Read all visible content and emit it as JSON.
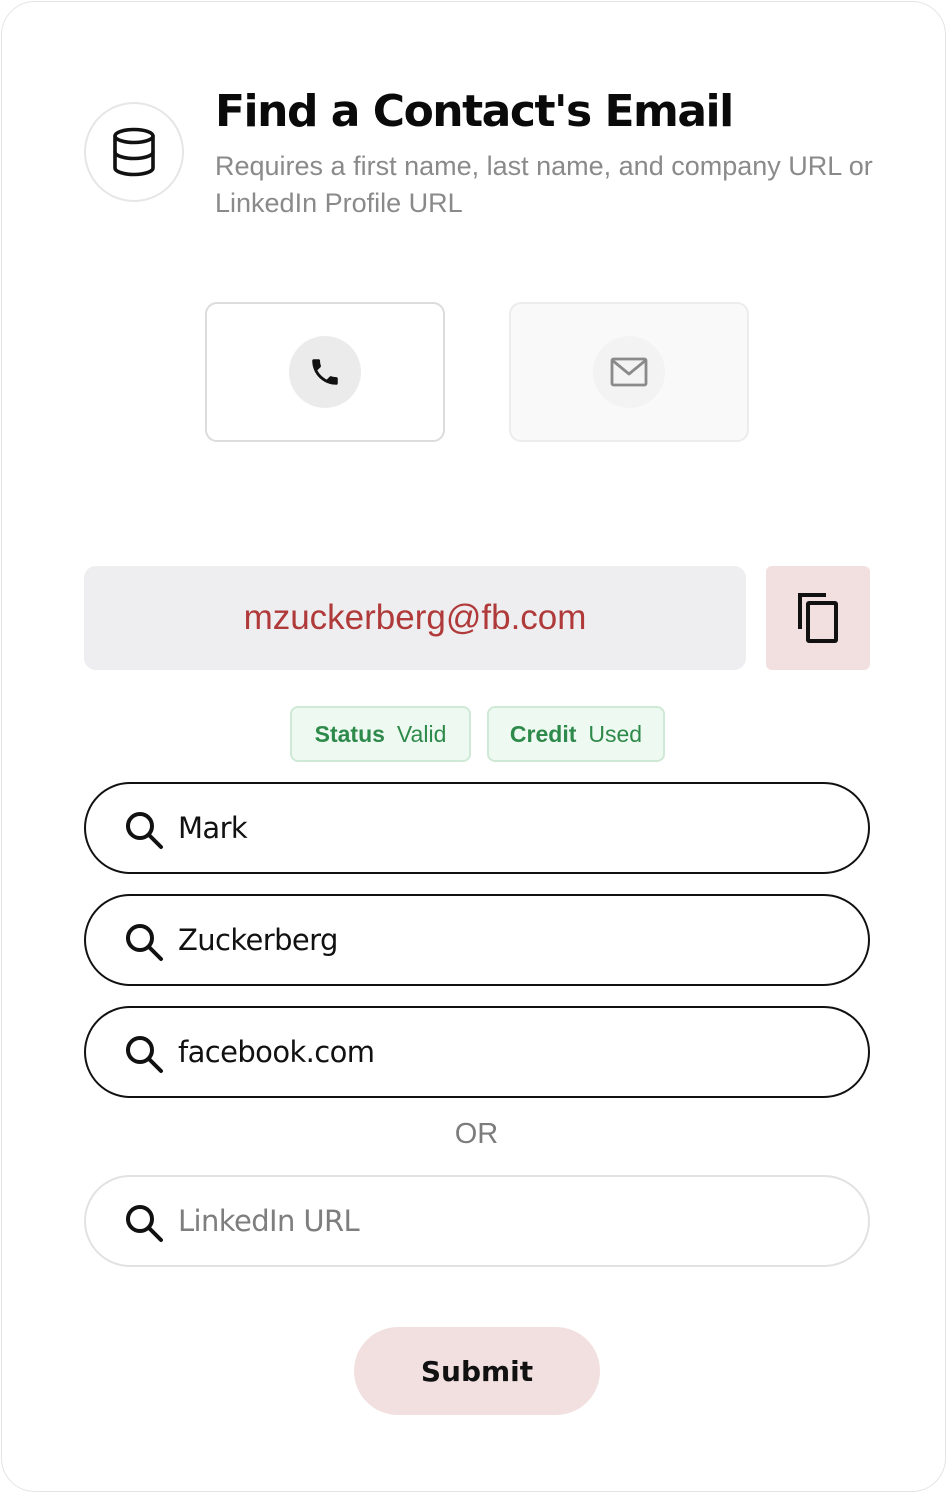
{
  "header": {
    "icon": "database-icon",
    "title": "Find a Contact's Email",
    "subtitle": "Requires a first name, last name, and company URL or LinkedIn Profile URL"
  },
  "modes": [
    {
      "icon": "phone-icon",
      "selected": true
    },
    {
      "icon": "mail-icon",
      "selected": false
    }
  ],
  "result": {
    "email": "mzuckerberg@fb.com",
    "copy_icon": "copy-icon"
  },
  "badges": {
    "status_key": "Status",
    "status_value": "Valid",
    "credit_key": "Credit",
    "credit_value": "Used"
  },
  "fields": {
    "first_name": "Mark",
    "last_name": "Zuckerberg",
    "company": "facebook.com",
    "linkedin_placeholder": "LinkedIn URL",
    "linkedin_value": ""
  },
  "or_label": "OR",
  "submit_label": "Submit",
  "colors": {
    "email_text": "#b03a3a",
    "accent_pink": "#f2e0e0",
    "badge_green": "#2e8a4a"
  }
}
